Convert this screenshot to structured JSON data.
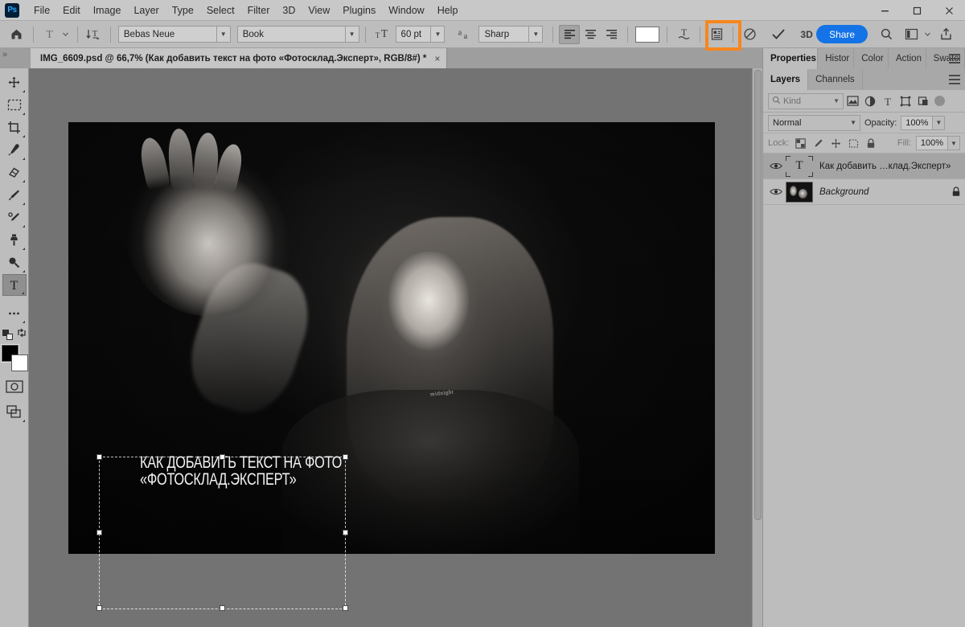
{
  "app": {
    "logo_text": "Ps",
    "menus": [
      "File",
      "Edit",
      "Image",
      "Layer",
      "Type",
      "Select",
      "Filter",
      "3D",
      "View",
      "Plugins",
      "Window",
      "Help"
    ],
    "window_buttons": [
      "minimize-button",
      "maximize-button",
      "close-button"
    ]
  },
  "options_bar": {
    "home_icon": "home-icon",
    "tool_preset": "type-tool-preset",
    "orientation_icon": "text-orientation-icon",
    "font_family": "Bebas Neue",
    "font_style": "Book",
    "size_icon": "font-size-icon",
    "font_size": "60 pt",
    "antialias_icon": "anti-aliasing-icon",
    "antialias": "Sharp",
    "align": [
      "align-left",
      "align-center",
      "align-right"
    ],
    "align_active": "align-left",
    "color_swatch": "#ffffff",
    "warp_icon": "warp-text-icon",
    "panels_icon": "character-paragraph-panels-icon",
    "cancel_icon": "cancel-edits-icon",
    "commit_icon": "commit-edits-icon",
    "three_d_label": "3D",
    "share_label": "Share",
    "search_icon": "search-icon",
    "workspace_icon": "workspace-switcher-icon",
    "workspace_arrow": "chevron-down-icon",
    "export_icon": "share-export-icon",
    "highlight_target": "commit-edits-button",
    "highlight_color": "#f7861f"
  },
  "document_tab": {
    "collapse_icon": "collapse-panels-icon",
    "title": "IMG_6609.psd @ 66,7% (Как добавить текст на фото «Фотосклад.Эксперт», RGB/8#) *",
    "close_icon": "close-tab-icon"
  },
  "toolbar": {
    "tools": [
      {
        "name": "move-tool",
        "glyph": "move",
        "selected": false,
        "has_submenu": true
      },
      {
        "name": "rectangular-marquee-tool",
        "glyph": "marquee",
        "selected": false,
        "has_submenu": true
      },
      {
        "name": "crop-tool",
        "glyph": "crop",
        "selected": false,
        "has_submenu": true
      },
      {
        "name": "eyedropper-tool",
        "glyph": "eyedropper",
        "selected": false,
        "has_submenu": true
      },
      {
        "name": "eraser-tool",
        "glyph": "eraser",
        "selected": false,
        "has_submenu": true
      },
      {
        "name": "brush-tool",
        "glyph": "brush",
        "selected": false,
        "has_submenu": true
      },
      {
        "name": "healing-brush-tool",
        "glyph": "healing",
        "selected": false,
        "has_submenu": true
      },
      {
        "name": "clone-stamp-tool",
        "glyph": "stamp",
        "selected": false,
        "has_submenu": true
      },
      {
        "name": "dodge-tool",
        "glyph": "dodge",
        "selected": false,
        "has_submenu": true
      },
      {
        "name": "horizontal-type-tool",
        "glyph": "type",
        "selected": true,
        "has_submenu": true
      },
      {
        "name": "edit-toolbar-button",
        "glyph": "ellipsis",
        "selected": false,
        "has_submenu": true
      }
    ],
    "quickmask_icon": "quick-mask-mode-icon",
    "screenmode_icon": "screen-mode-icon",
    "swap_icon": "swap-colors-icon",
    "default_colors_icon": "default-colors-icon",
    "foreground_color": "#000000",
    "background_color": "#ffffff"
  },
  "canvas": {
    "zoom_label": "66,7%",
    "image_alt": "black-and-white-portrait-woman-hand-raised",
    "shirt_text": "midnight",
    "overlay_text_line1": "КАК ДОБАВИТЬ ТЕКСТ НА ФОТО",
    "overlay_text_line2": "«ФОТОСКЛАД.ЭКСПЕРТ»",
    "textbox_handles": 8,
    "scrollbar": "vertical-scrollbar"
  },
  "panels": {
    "top_tabs": [
      {
        "label": "Properties",
        "active": true
      },
      {
        "label": "Histor",
        "active": false
      },
      {
        "label": "Color",
        "active": false
      },
      {
        "label": "Action",
        "active": false
      },
      {
        "label": "Swatcl",
        "active": false
      }
    ],
    "top_menu_icon": "panel-menu-icon",
    "layer_tabs": [
      {
        "label": "Layers",
        "active": true
      },
      {
        "label": "Channels",
        "active": false
      }
    ],
    "layers_menu_icon": "layers-panel-menu-icon",
    "filter": {
      "search_icon": "search-icon",
      "kind_label": "Kind",
      "kind_arrow": "chevron-down-icon",
      "type_filters": [
        "pixel-layers-filter-icon",
        "adjustment-layers-filter-icon",
        "type-layers-filter-icon",
        "shape-layers-filter-icon",
        "smart-object-filter-icon"
      ],
      "toggle": "filter-toggle-switch"
    },
    "blend": {
      "mode": "Normal",
      "mode_arrow": "chevron-down-icon",
      "opacity_label": "Opacity:",
      "opacity_value": "100%",
      "opacity_arrow": "chevron-down-icon"
    },
    "lock": {
      "label": "Lock:",
      "icons": [
        "lock-transparent-pixels-icon",
        "lock-image-pixels-icon",
        "lock-position-icon",
        "lock-artboard-nesting-icon",
        "lock-all-icon"
      ],
      "fill_label": "Fill:",
      "fill_value": "100%",
      "fill_arrow": "chevron-down-icon"
    },
    "layers": [
      {
        "name": "Как добавить …клад.Эксперт»",
        "thumb": "type-layer-thumbnail",
        "visible": true,
        "selected": true,
        "italic": false,
        "locked": false,
        "eye_icon": "eye-icon"
      },
      {
        "name": "Background",
        "thumb": "background-layer-thumbnail",
        "visible": true,
        "selected": false,
        "italic": true,
        "locked": true,
        "eye_icon": "eye-icon",
        "lock_icon": "lock-icon"
      }
    ]
  }
}
